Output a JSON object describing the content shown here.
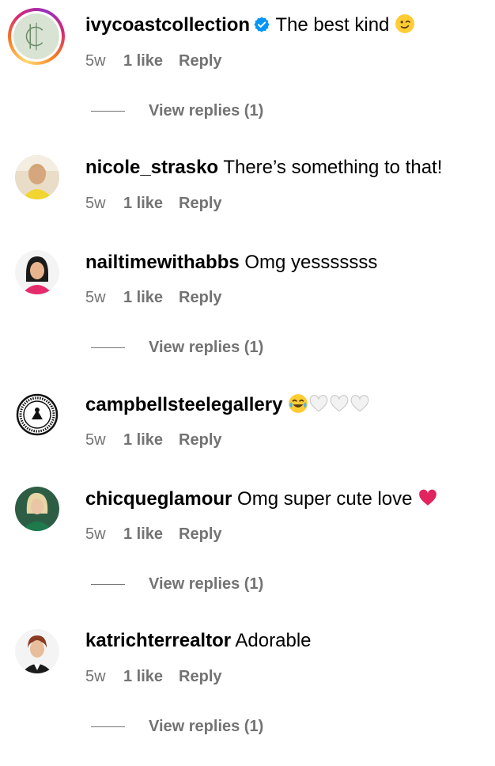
{
  "comments": [
    {
      "username": "ivycoastcollection",
      "text": "The best kind",
      "emoji": "winking-face",
      "time": "5w",
      "likes": "1 like",
      "reply": "Reply",
      "view_replies": "View replies (1)"
    },
    {
      "username": "nicole_strasko",
      "text": "There’s something to that!",
      "time": "5w",
      "likes": "1 like",
      "reply": "Reply"
    },
    {
      "username": "nailtimewithabbs",
      "text": "Omg yesssssss",
      "time": "5w",
      "likes": "1 like",
      "reply": "Reply",
      "view_replies": "View replies (1)"
    },
    {
      "username": "campbellsteelegallery",
      "emoji": "face-with-tears-of-joy, white-heart x3",
      "time": "5w",
      "likes": "1 like",
      "reply": "Reply"
    },
    {
      "username": "chicqueglamour",
      "text": "Omg super cute love",
      "emoji": "red-heart",
      "time": "5w",
      "likes": "1 like",
      "reply": "Reply",
      "view_replies": "View replies (1)"
    },
    {
      "username": "katrichterrealtor",
      "text": "Adorable",
      "time": "5w",
      "likes": "1 like",
      "reply": "Reply",
      "view_replies": "View replies (1)"
    }
  ],
  "colors": {
    "secondary_text": "#737373",
    "verified_badge": "#0095f6",
    "red_heart": "#e0245e"
  }
}
